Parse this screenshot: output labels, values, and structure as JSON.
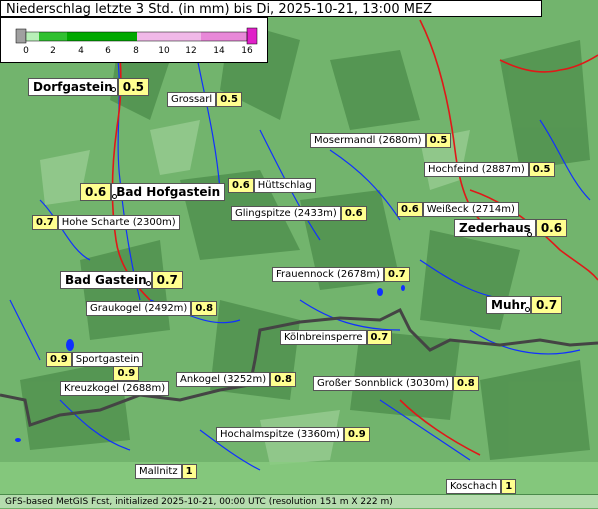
{
  "header": {
    "title": "Niederschlag letzte 3 Std. (in mm) bis Di, 2025-10-21, 13:00 MEZ"
  },
  "legend": {
    "ticks": [
      "0",
      "2",
      "4",
      "6",
      "8",
      "10",
      "12",
      "14",
      "16"
    ],
    "colors": {
      "gray": "#a0a0a0",
      "green_light": "#b8f0b8",
      "green_mid": "#38d038",
      "green_dark": "#00a000",
      "pink_light": "#f0c0e8",
      "pink_mid": "#e888d8",
      "magenta": "#e020c8"
    }
  },
  "towns": [
    {
      "name": "Dorfgastein",
      "value": "0.5"
    },
    {
      "name": "Bad Hofgastein",
      "value": "0.6"
    },
    {
      "name": "Bad Gastein",
      "value": "0.7"
    },
    {
      "name": "Zederhaus",
      "value": "0.6"
    },
    {
      "name": "Muhr",
      "value": "0.7"
    }
  ],
  "places": [
    {
      "name": "Grossarl",
      "value": "0.5"
    },
    {
      "name": "Mosermandl (2680m)",
      "value": "0.5"
    },
    {
      "name": "Hochfeind (2887m)",
      "value": "0.5"
    },
    {
      "name": "Hüttschlag",
      "value": "0.6"
    },
    {
      "name": "Hohe Scharte (2300m)",
      "value": "0.7"
    },
    {
      "name": "Glingspitze (2433m)",
      "value": "0.6"
    },
    {
      "name": "Weißeck (2714m)",
      "value": "0.6"
    },
    {
      "name": "Frauennock (2678m)",
      "value": "0.7"
    },
    {
      "name": "Graukogel (2492m)",
      "value": "0.8"
    },
    {
      "name": "Kölnbreinsperre",
      "value": "0.7"
    },
    {
      "name": "Sportgastein",
      "value": "0.9"
    },
    {
      "name": "Kreuzkogel (2688m)",
      "value": "0.9"
    },
    {
      "name": "Ankogel (3252m)",
      "value": "0.8"
    },
    {
      "name": "Großer Sonnblick (3030m)",
      "value": "0.8"
    },
    {
      "name": "Hochalmspitze (3360m)",
      "value": "0.9"
    },
    {
      "name": "Mallnitz",
      "value": "1"
    },
    {
      "name": "Koschach",
      "value": "1"
    }
  ],
  "footer": {
    "text": "GFS-based MetGIS Fcst, initialized 2025-10-21, 00:00 UTC  (resolution 151 m X 222 m)"
  }
}
